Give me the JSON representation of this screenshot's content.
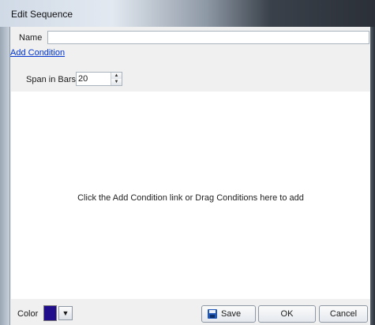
{
  "window": {
    "title": "Edit Sequence"
  },
  "name": {
    "label": "Name",
    "value": ""
  },
  "add_condition_link": "Add Condition",
  "span": {
    "label": "Span in Bars",
    "value": "20"
  },
  "drop_area": {
    "hint": "Click the Add Condition link or Drag Conditions here to add"
  },
  "color": {
    "label": "Color",
    "swatch": "#1f0d8c"
  },
  "buttons": {
    "save": "Save",
    "ok": "OK",
    "cancel": "Cancel"
  }
}
